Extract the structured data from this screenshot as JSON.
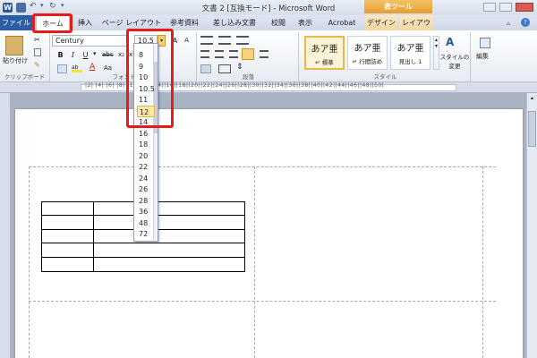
{
  "title_bar": {
    "title": "文書 2 [互換モード] - Microsoft Word",
    "context_group": "表ツール"
  },
  "tabs": [
    {
      "label": "ファイル"
    },
    {
      "label": "ホーム"
    },
    {
      "label": "挿入"
    },
    {
      "label": "ページ レイアウト"
    },
    {
      "label": "参考資料"
    },
    {
      "label": "差し込み文書"
    },
    {
      "label": "校閲"
    },
    {
      "label": "表示"
    },
    {
      "label": "Acrobat"
    },
    {
      "label": "デザイン"
    },
    {
      "label": "レイアウト"
    }
  ],
  "ribbon": {
    "clipboard": {
      "paste_label": "貼り付け",
      "group_label": "クリップボード"
    },
    "font": {
      "name": "Century",
      "size": "10.5",
      "group_label": "フォント",
      "bold": "B",
      "italic": "I",
      "underline": "U",
      "strike": "abc",
      "sub": "x₂",
      "sup": "x²",
      "color_a": "A",
      "aa": "Aa"
    },
    "paragraph": {
      "group_label": "段落"
    },
    "styles": {
      "group_label": "スタイル",
      "items": [
        {
          "sample": "あア亜",
          "name": "↵ 標準"
        },
        {
          "sample": "あア亜",
          "name": "↵ 行間詰め"
        },
        {
          "sample": "あア亜",
          "name": "見出し 1"
        }
      ],
      "change_label": "スタイルの\n変更"
    },
    "edit": {
      "label": "編集"
    }
  },
  "ruler": {
    "text": "|2|  |4| |6| |8| |10||12||14||16||18||20||22||24||26||28||30||32||34||36||38||40||42||44||46||48||50|"
  },
  "font_size_options": [
    "8",
    "9",
    "10",
    "10.5",
    "11",
    "12",
    "14",
    "16",
    "18",
    "20",
    "22",
    "24",
    "26",
    "28",
    "36",
    "48",
    "72"
  ],
  "font_size_hover": "12",
  "colors": {
    "accent_red": "#e41c1c",
    "file_tab": "#2a5fa8",
    "context_orange": "#e59f2e"
  }
}
